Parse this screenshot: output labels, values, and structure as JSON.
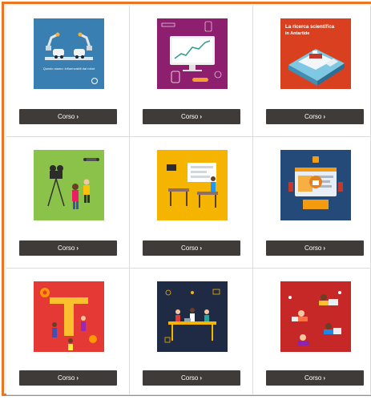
{
  "accent_color": "#e87722",
  "button_color": "#3f3b38",
  "cards": [
    {
      "button_label": "Corso",
      "image_caption": "Questo siamo: influenzabili dai robot",
      "icon": "robots-cars-image"
    },
    {
      "button_label": "Corso",
      "icon": "monitor-chart-image"
    },
    {
      "button_label": "Corso",
      "image_title_line1": "La ricerca scientifica",
      "image_title_line2": "in Antartide",
      "icon": "antarctic-ship-image"
    },
    {
      "button_label": "Corso",
      "icon": "film-crew-image"
    },
    {
      "button_label": "Corso",
      "icon": "classroom-screen-image"
    },
    {
      "button_label": "Corso",
      "icon": "cyber-security-image"
    },
    {
      "button_label": "Corso",
      "icon": "teamwork-gears-image"
    },
    {
      "button_label": "Corso",
      "icon": "coworking-table-image"
    },
    {
      "button_label": "Corso",
      "icon": "remote-learning-image"
    }
  ],
  "chevron": "›"
}
